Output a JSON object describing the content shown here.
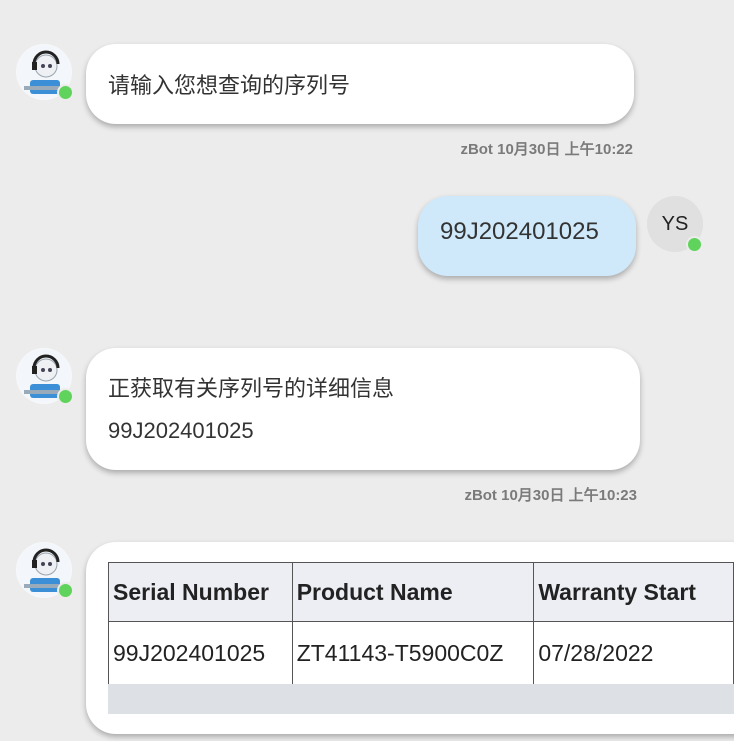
{
  "messages": [
    {
      "sender": "bot",
      "text": "请输入您想查询的序列号",
      "meta": "zBot 10月30日 上午10:22"
    },
    {
      "sender": "user",
      "text": "99J202401025",
      "avatar": "YS"
    },
    {
      "sender": "bot",
      "line1": "正获取有关序列号的详细信息",
      "line2": "99J202401025",
      "meta": "zBot 10月30日 上午10:23"
    }
  ],
  "table": {
    "headers": [
      "Serial Number",
      "Product Name",
      "Warranty Start"
    ],
    "rows": [
      [
        "99J202401025",
        "ZT41143-T5900C0Z",
        "07/28/2022"
      ]
    ]
  },
  "colors": {
    "online": "#5fd35b",
    "user_bubble": "#cfe9fb"
  }
}
